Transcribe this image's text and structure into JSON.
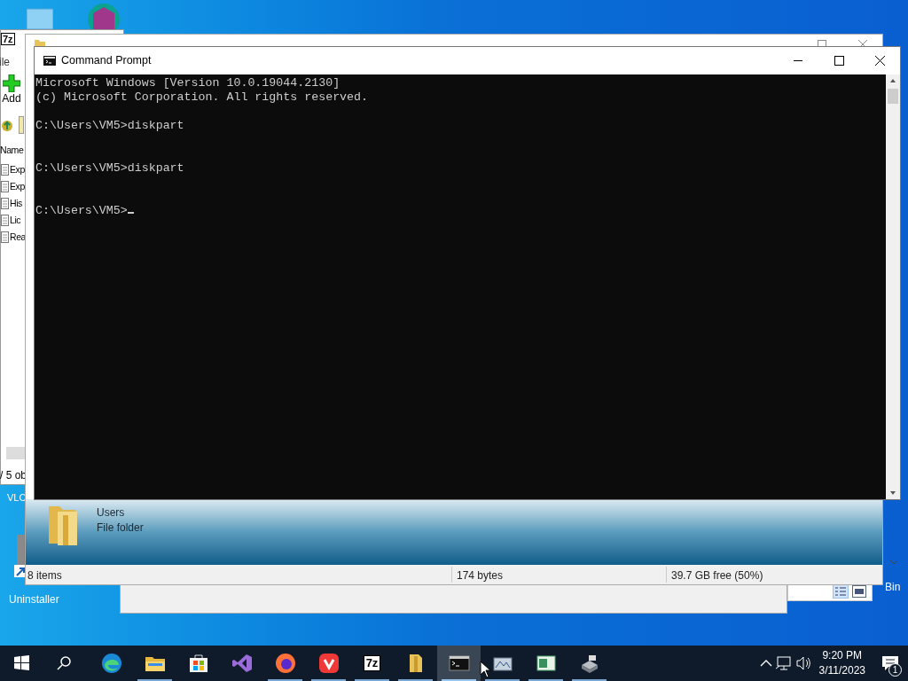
{
  "desktop": {
    "icons": [
      {
        "kind": "vlc",
        "label": "VLC"
      },
      {
        "kind": "revo",
        "label": "Uninstaller"
      },
      {
        "kind": "bin",
        "label": "Bin"
      }
    ]
  },
  "archiver_window": {
    "logo": "7z",
    "menu_fragment": "ile",
    "toolbar_button": "Add",
    "column_header": "Name",
    "rows": [
      "Exp",
      "Exp",
      "His",
      "Lic",
      "Rea"
    ],
    "status": "/ 5 ob"
  },
  "explorer_window": {
    "details_name": "Users",
    "details_type": "File folder",
    "status": [
      "8 items",
      "174 bytes",
      "39.7 GB free (50%)"
    ]
  },
  "console_window": {
    "title": "Command Prompt",
    "header": [
      "Microsoft Windows [Version 10.0.19044.2130]",
      "(c) Microsoft Corporation. All rights reserved."
    ],
    "commands": [
      {
        "text": "C:\\Users\\VM5>diskpart",
        "cursor": false
      },
      {
        "text": "C:\\Users\\VM5>diskpart",
        "cursor": false
      },
      {
        "text": "C:\\Users\\VM5>",
        "cursor": true
      }
    ]
  },
  "taskbar": {
    "apps": [
      {
        "kind": "edge",
        "running": false,
        "selected": false
      },
      {
        "kind": "explorer",
        "running": true,
        "selected": false
      },
      {
        "kind": "store",
        "running": false,
        "selected": false
      },
      {
        "kind": "vs",
        "running": false,
        "selected": false
      },
      {
        "kind": "firefox",
        "running": true,
        "selected": false
      },
      {
        "kind": "vivaldi",
        "running": true,
        "selected": false
      },
      {
        "kind": "sevenzip",
        "text": "7z",
        "running": true,
        "selected": false
      },
      {
        "kind": "folder",
        "running": true,
        "selected": false
      },
      {
        "kind": "console",
        "running": true,
        "selected": true
      },
      {
        "kind": "diskmgmt",
        "running": true,
        "selected": false
      },
      {
        "kind": "window",
        "running": true,
        "selected": false
      },
      {
        "kind": "drive",
        "running": true,
        "selected": false
      }
    ],
    "time": "9:20 PM",
    "date": "3/11/2023",
    "notification_count": "1"
  }
}
